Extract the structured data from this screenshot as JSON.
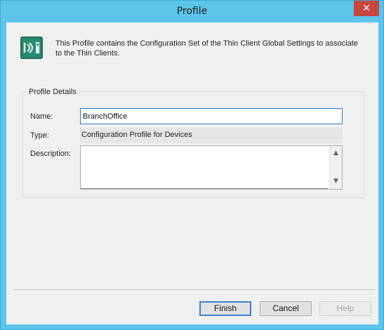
{
  "window": {
    "title": "Profile",
    "close_symbol": "✕",
    "colors": {
      "frame": "#5ec5ea",
      "close": "#c7473f",
      "client": "#f0f0f0"
    }
  },
  "header": {
    "icon": "thin-client-icon",
    "description": "This Profile contains the Configuration Set of the Thin Client Global Settings to associate to the Thin Clients."
  },
  "profile_details": {
    "group_label": "Profile Details",
    "name_label": "Name:",
    "name_value": "BranchOffice",
    "type_label": "Type:",
    "type_value": "Configuration Profile for Devices",
    "description_label": "Description:",
    "description_value": ""
  },
  "buttons": {
    "finish": "Finish",
    "cancel": "Cancel",
    "help": "Help"
  }
}
